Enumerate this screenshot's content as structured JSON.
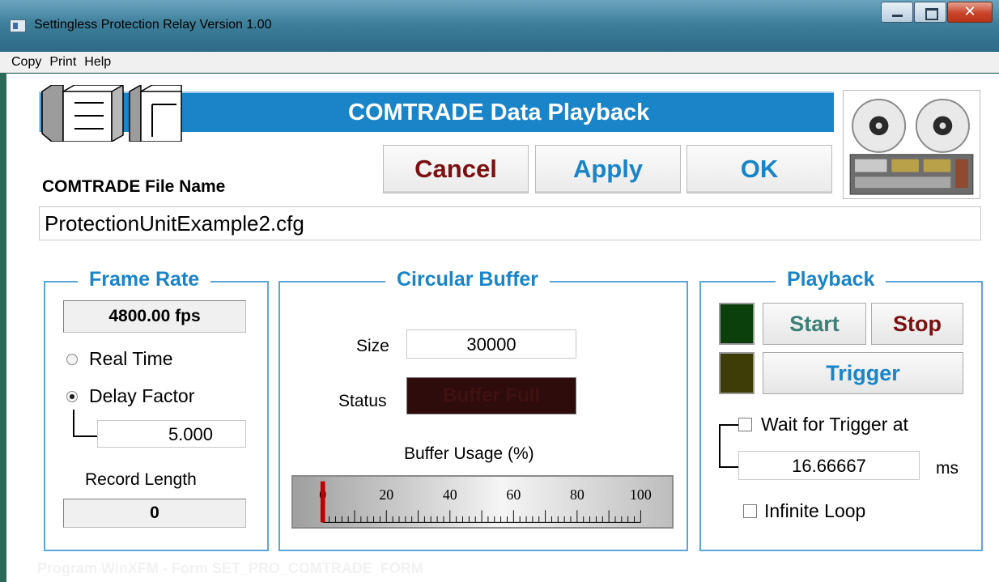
{
  "window": {
    "title": "Settingless Protection Relay Version 1.00"
  },
  "menu": [
    "Copy",
    "Print",
    "Help"
  ],
  "header": {
    "title": "COMTRADE Data Playback"
  },
  "buttons": {
    "cancel": "Cancel",
    "apply": "Apply",
    "ok": "OK"
  },
  "file": {
    "label": "COMTRADE File Name",
    "value": "ProtectionUnitExample2.cfg"
  },
  "frame_rate": {
    "title": "Frame Rate",
    "fps": "4800.00 fps",
    "real_time_label": "Real Time",
    "delay_factor_label": "Delay Factor",
    "delay_factor_value": "5.000",
    "mode_selected": "Delay Factor",
    "record_length_label": "Record Length",
    "record_length_value": "0"
  },
  "buffer": {
    "title": "Circular Buffer",
    "size_label": "Size",
    "size_value": "30000",
    "status_label": "Status",
    "status_value": "Buffer Full",
    "usage_label": "Buffer Usage (%)",
    "gauge_ticks": [
      "0",
      "20",
      "40",
      "60",
      "80",
      "100"
    ],
    "usage_value": 0
  },
  "playback": {
    "title": "Playback",
    "start_label": "Start",
    "stop_label": "Stop",
    "trigger_label": "Trigger",
    "wait_label": "Wait for Trigger at",
    "wait_checked": false,
    "wait_value": "16.66667",
    "wait_unit": "ms",
    "loop_label": "Infinite Loop",
    "loop_checked": false
  },
  "colors": {
    "accent": "#1a84c8",
    "cancel_text": "#7a1010",
    "start_text": "#3c7f77",
    "stop_text": "#7a1010",
    "status_bg": "#2e0c0c",
    "led_start": "#0b3f0b",
    "led_trigger": "#3d3d08",
    "gauge_needle": "#c00000"
  },
  "footer": {
    "text": "Program WinXFM - Form SET_PRO_COMTRADE_FORM"
  }
}
